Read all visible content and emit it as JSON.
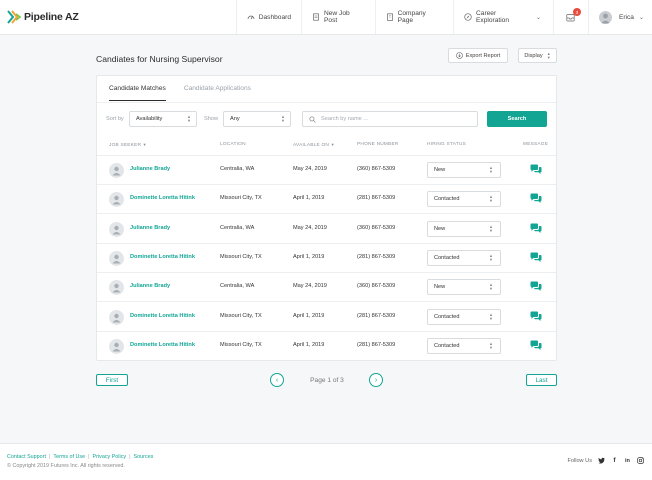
{
  "brand": {
    "name": "Pipeline AZ",
    "accent": "#12a594"
  },
  "nav": {
    "dashboard": "Dashboard",
    "new_job_post": "New Job Post",
    "company_page": "Company Page",
    "career_exploration": "Career Exploration",
    "notifications_count": "3",
    "user_name": "Erica"
  },
  "page": {
    "title": "Candiates for Nursing Supervisor",
    "export_label": "Export Report",
    "display_label": "Display"
  },
  "tabs": {
    "matches": "Candidate Matches",
    "applications": "Candidate Applications"
  },
  "filters": {
    "sort_label": "Sort by",
    "sort_value": "Availability",
    "show_label": "Show",
    "show_value": "Any",
    "search_placeholder": "Search by name ...",
    "search_button": "Search"
  },
  "table": {
    "headers": {
      "job_seeker": "JOB SEEKER",
      "location": "LOCATION",
      "available_on": "AVAILABLE ON",
      "phone": "PHONE NUMBER",
      "hiring_status": "HIRING STATUS",
      "message": "MESSAGE"
    },
    "rows": [
      {
        "name": "Julianne Brady",
        "location": "Centralia, WA",
        "available": "May 24, 2019",
        "phone": "(360) 867-5309",
        "status": "New"
      },
      {
        "name": "Dominette Loretta Hitink",
        "location": "Missouri City, TX",
        "available": "April 1, 2019",
        "phone": "(281) 867-5309",
        "status": "Contacted"
      },
      {
        "name": "Julianne Brady",
        "location": "Centralia, WA",
        "available": "May 24, 2019",
        "phone": "(360) 867-5309",
        "status": "New"
      },
      {
        "name": "Dominette Loretta Hitink",
        "location": "Missouri City, TX",
        "available": "April 1, 2019",
        "phone": "(281) 867-5309",
        "status": "Contacted"
      },
      {
        "name": "Julianne Brady",
        "location": "Centralia, WA",
        "available": "May 24, 2019",
        "phone": "(360) 867-5309",
        "status": "New"
      },
      {
        "name": "Dominette Loretta Hitink",
        "location": "Missouri City, TX",
        "available": "April 1, 2019",
        "phone": "(281) 867-5309",
        "status": "Contacted"
      },
      {
        "name": "Dominette Loretta Hitink",
        "location": "Missouri City, TX",
        "available": "April 1, 2019",
        "phone": "(281) 867-5309",
        "status": "Contacted"
      }
    ]
  },
  "pagination": {
    "first": "First",
    "last": "Last",
    "info": "Page 1 of 3"
  },
  "footer": {
    "links": [
      "Contact Support",
      "Terms of Use",
      "Privacy Policy",
      "Sources"
    ],
    "copyright": "© Copyright 2019 Futures Inc. All rights reserved.",
    "follow_label": "Follow Us",
    "social": [
      "twitter-icon",
      "facebook-icon",
      "linkedin-icon",
      "instagram-icon"
    ]
  }
}
